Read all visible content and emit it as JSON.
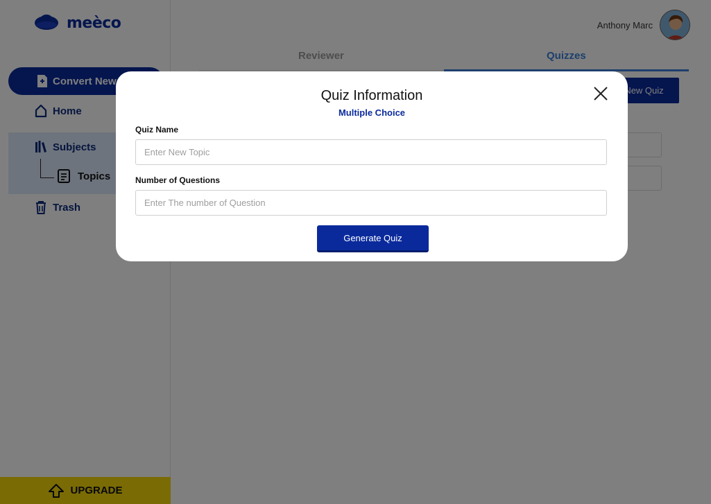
{
  "app": {
    "brand": "meèco",
    "brand_color": "#0a2a9c"
  },
  "user": {
    "name": "Anthony Marc"
  },
  "sidebar": {
    "convert_label": "Convert New",
    "items": [
      {
        "label": "Home",
        "icon": "home-icon"
      },
      {
        "label": "Subjects",
        "icon": "books-icon"
      },
      {
        "label": "Topics",
        "icon": "note-icon"
      },
      {
        "label": "Trash",
        "icon": "trash-icon"
      }
    ],
    "upgrade_label": "UPGRADE"
  },
  "tabs": [
    {
      "label": "Reviewer",
      "active": false
    },
    {
      "label": "Quizzes",
      "active": true
    }
  ],
  "main": {
    "new_quiz_label": "New  Quiz"
  },
  "modal": {
    "title": "Quiz Information",
    "subtitle": "Multiple Choice",
    "fields": [
      {
        "label": "Quiz Name",
        "placeholder": "Enter New Topic",
        "value": ""
      },
      {
        "label": "Number of Questions",
        "placeholder": "Enter The number of Question",
        "value": ""
      }
    ],
    "submit_label": "Generate Quiz"
  },
  "colors": {
    "primary": "#0a2a9c",
    "accent": "#3a7fd9",
    "upgrade": "#f5d60a",
    "overlay": "rgba(0,0,0,0.5)"
  }
}
